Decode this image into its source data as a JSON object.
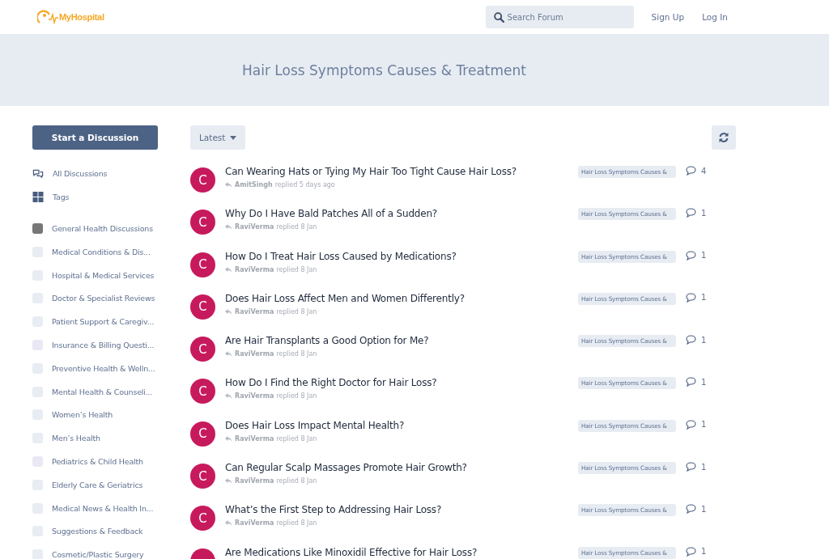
{
  "header": {
    "logo": "MyHospital",
    "search": {
      "placeholder": "Search Forum"
    },
    "links": [
      "Sign Up",
      "Log In"
    ]
  },
  "hero": {
    "title": "Hair Loss Symptoms Causes & Treatment"
  },
  "sidebar": {
    "start_button": "Start a Discussion",
    "nav": [
      {
        "label": "All Discussions",
        "kind": "discussions"
      },
      {
        "label": "Tags",
        "kind": "tags"
      }
    ],
    "categories": [
      {
        "label": "General Health Discussions",
        "color": "#777777"
      },
      {
        "label": "Medical Conditions & Dis...",
        "color": "#e8ecf3"
      },
      {
        "label": "Hospital & Medical Services",
        "color": "#e8ecf3"
      },
      {
        "label": "Doctor & Specialist Reviews",
        "color": "#e8ecf3"
      },
      {
        "label": "Patient Support & Caregiv...",
        "color": "#e8ecf3"
      },
      {
        "label": "Insurance & Billing Questi...",
        "color": "#ebe8f5"
      },
      {
        "label": "Preventive Health & Welln...",
        "color": "#e8ecf3"
      },
      {
        "label": "Mental Health & Counseli...",
        "color": "#e8ecf3"
      },
      {
        "label": "Women’s Health",
        "color": "#e8ecf3"
      },
      {
        "label": "Men’s Health",
        "color": "#e8ecf3"
      },
      {
        "label": "Pediatrics & Child Health",
        "color": "#ebe8f5"
      },
      {
        "label": "Elderly Care & Geriatrics",
        "color": "#e8ecf3"
      },
      {
        "label": "Medical News & Health In...",
        "color": "#e8ecf3"
      },
      {
        "label": "Suggestions & Feedback",
        "color": "#e8ecf3"
      },
      {
        "label": "Cosmetic/Plastic Surgery",
        "color": "#e8ecf3"
      }
    ]
  },
  "toolbar": {
    "sort": "Latest"
  },
  "discussions": [
    {
      "avatar": "C",
      "title": "Can Wearing Hats or Tying My Hair Too Tight Cause Hair Loss?",
      "user": "AmitSingh",
      "action": "replied 5 days ago",
      "tag": "Hair Loss Symptoms Causes &",
      "replies": "4"
    },
    {
      "avatar": "C",
      "title": "Why Do I Have Bald Patches All of a Sudden?",
      "user": "RaviVerma",
      "action": "replied 8 Jan",
      "tag": "Hair Loss Symptoms Causes &",
      "replies": "1"
    },
    {
      "avatar": "C",
      "title": "How Do I Treat Hair Loss Caused by Medications?",
      "user": "RaviVerma",
      "action": "replied 8 Jan",
      "tag": "Hair Loss Symptoms Causes &",
      "replies": "1"
    },
    {
      "avatar": "C",
      "title": "Does Hair Loss Affect Men and Women Differently?",
      "user": "RaviVerma",
      "action": "replied 8 Jan",
      "tag": "Hair Loss Symptoms Causes &",
      "replies": "1"
    },
    {
      "avatar": "C",
      "title": "Are Hair Transplants a Good Option for Me?",
      "user": "RaviVerma",
      "action": "replied 8 Jan",
      "tag": "Hair Loss Symptoms Causes &",
      "replies": "1"
    },
    {
      "avatar": "C",
      "title": "How Do I Find the Right Doctor for Hair Loss?",
      "user": "RaviVerma",
      "action": "replied 8 Jan",
      "tag": "Hair Loss Symptoms Causes &",
      "replies": "1"
    },
    {
      "avatar": "C",
      "title": "Does Hair Loss Impact Mental Health?",
      "user": "RaviVerma",
      "action": "replied 8 Jan",
      "tag": "Hair Loss Symptoms Causes &",
      "replies": "1"
    },
    {
      "avatar": "C",
      "title": "Can Regular Scalp Massages Promote Hair Growth?",
      "user": "RaviVerma",
      "action": "replied 8 Jan",
      "tag": "Hair Loss Symptoms Causes &",
      "replies": "1"
    },
    {
      "avatar": "C",
      "title": "What’s the First Step to Addressing Hair Loss?",
      "user": "RaviVerma",
      "action": "replied 8 Jan",
      "tag": "Hair Loss Symptoms Causes &",
      "replies": "1"
    },
    {
      "title": "Are Medications Like Minoxidil Effective for Hair Loss?",
      "tag": "Hair Loss Symptoms Causes &",
      "replies": "1"
    }
  ]
}
